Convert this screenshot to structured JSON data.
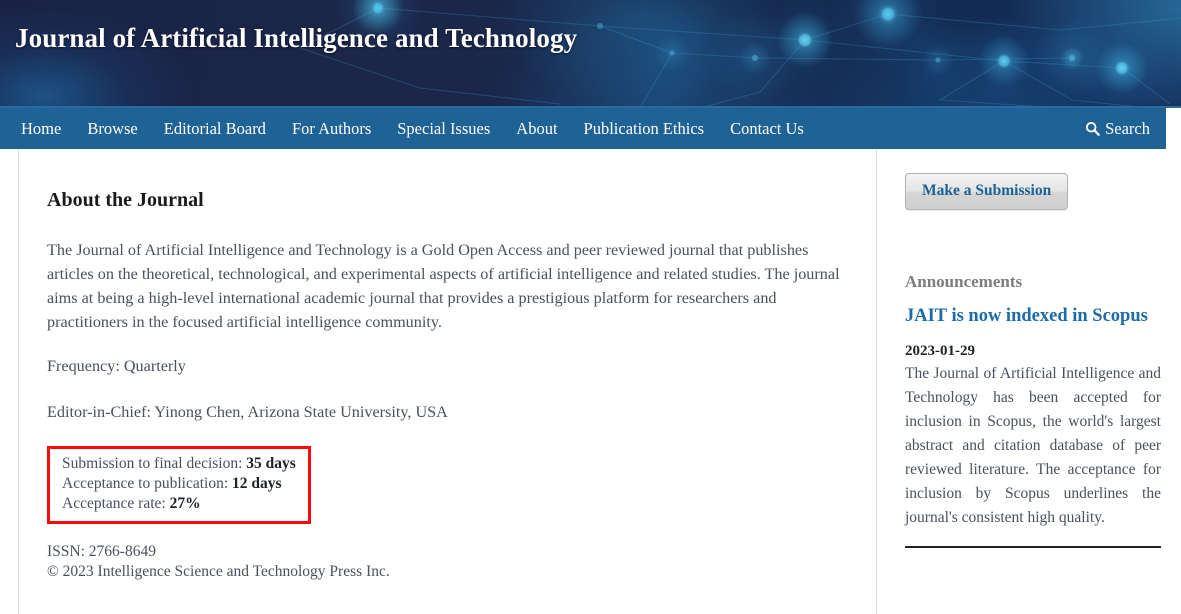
{
  "header": {
    "title": "Journal of Artificial Intelligence and Technology"
  },
  "nav": {
    "items": [
      {
        "label": "Home"
      },
      {
        "label": "Browse"
      },
      {
        "label": "Editorial Board"
      },
      {
        "label": "For Authors"
      },
      {
        "label": "Special Issues"
      },
      {
        "label": "About"
      },
      {
        "label": "Publication Ethics"
      },
      {
        "label": "Contact Us"
      }
    ],
    "search_label": "Search",
    "search_icon": "search-icon"
  },
  "main": {
    "page_title": "About the Journal",
    "intro_paragraph": "The Journal of Artificial Intelligence and Technology is a Gold Open Access and peer reviewed journal that publishes articles on the theoretical, technological, and experimental aspects of artificial intelligence and related studies. The journal aims at being a high-level international academic journal that provides a prestigious platform for researchers and practitioners in the focused artificial intelligence community.",
    "frequency": "Frequency: Quarterly",
    "editor_in_chief": "Editor-in-Chief: Yinong Chen, Arizona State University, USA",
    "metrics": {
      "highlight_color": "#fa0a0a",
      "rows": [
        {
          "label": "Submission to final decision:",
          "value": "35 days"
        },
        {
          "label": "Acceptance to publication:",
          "value": "12 days"
        },
        {
          "label": "Acceptance rate:",
          "value": "27%"
        }
      ]
    },
    "issn": "ISSN: 2766-8649",
    "copyright": "© 2023 Intelligence Science and Technology Press Inc."
  },
  "sidebar": {
    "submission_button": "Make a Submission",
    "announcements_heading": "Announcements",
    "announcement": {
      "title": "JAIT is now indexed in Scopus",
      "date": "2023-01-29",
      "body": "The Journal of Artificial Intelligence and Technology has been accepted for inclusion in Scopus, the world's largest abstract and citation database of peer reviewed literature. The acceptance for inclusion by Scopus underlines the journal's consistent high quality."
    }
  },
  "theme": {
    "banner_bg": "#1b2447",
    "nav_bg": "#1f6296",
    "link_blue": "#1b6ca8",
    "body_text": "#49515c",
    "muted": "#7d7d7d"
  }
}
